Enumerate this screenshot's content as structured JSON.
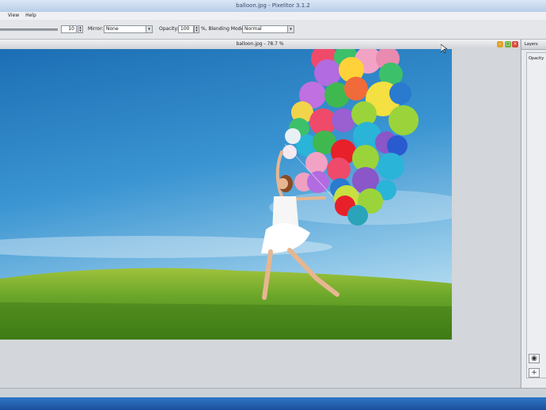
{
  "window": {
    "title": "balloon.jpg - Pixelitor 3.1.2"
  },
  "menubar": {
    "items": [
      "",
      "View",
      "Help"
    ]
  },
  "toolbar": {
    "size_value": "10",
    "mirror_label": "Mirror:",
    "mirror_value": "None",
    "opacity_label": "Opacity:",
    "opacity_value": "100",
    "blending_label": "%, Blending Mode:",
    "blending_value": "Normal"
  },
  "document": {
    "title": "balloon.jpg - 78.7 %"
  },
  "layers_panel": {
    "title": "Layers",
    "opacity_label": "Opacity"
  },
  "icons": {
    "spin": "spinner-arrows-icon",
    "dropdown": "chevron-down-icon",
    "minimize": "minimize-icon",
    "maximize": "maximize-icon",
    "close": "close-icon",
    "visibility": "eye-icon",
    "add_layer": "plus-icon"
  },
  "colors": {
    "sky": "#2f86c8",
    "grass": "#5a9a22",
    "taskbar": "#2263b3"
  }
}
